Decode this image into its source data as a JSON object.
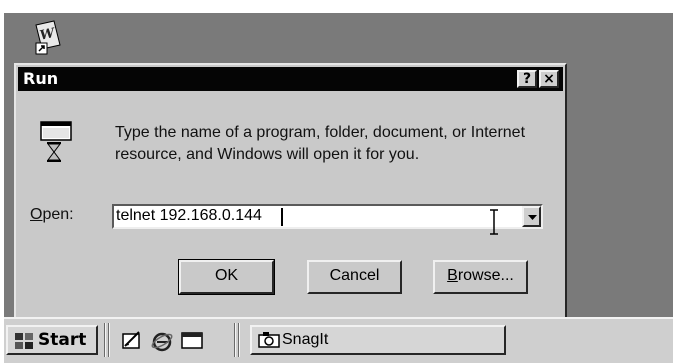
{
  "dialog": {
    "title": "Run",
    "help_button": "?",
    "close_button": "×",
    "description": "Type the name of a program, folder, document, or Internet resource, and Windows will open it for you.",
    "open_label_mnemonic": "O",
    "open_label_rest": "pen:",
    "open_value": "telnet 192.168.0.144",
    "ok_label": "OK",
    "cancel_label": "Cancel",
    "browse_label_mnemonic": "B",
    "browse_label_rest": "rowse..."
  },
  "taskbar": {
    "start_label": "Start",
    "task_label": "SnagIt"
  },
  "icons": {
    "desktop_icon": "word-document-shortcut-icon",
    "run_icon": "run-program-hourglass-icon",
    "quicklaunch": [
      "show-desktop-icon",
      "internet-explorer-icon",
      "outlook-express-icon"
    ],
    "start": "windows-logo-icon",
    "task": "snagit-camera-icon"
  }
}
